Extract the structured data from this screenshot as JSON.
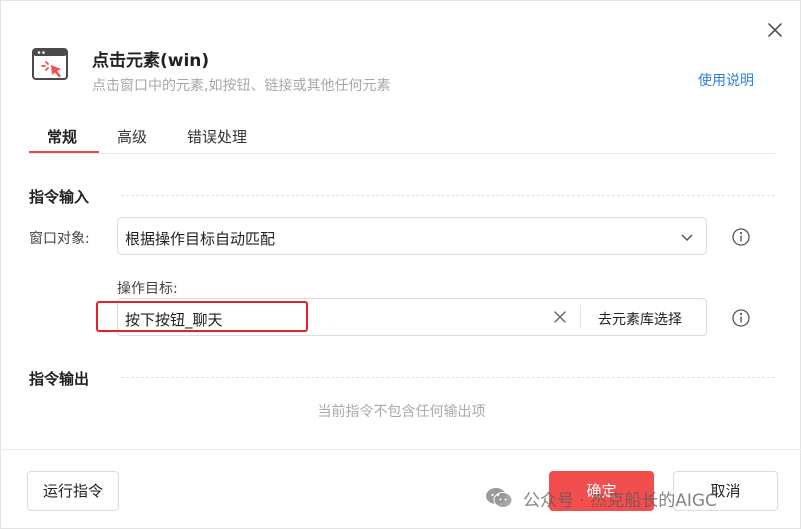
{
  "dialog": {
    "title": "点击元素(win)",
    "subtitle": "点击窗口中的元素,如按钮、链接或其他任何元素",
    "help_link": "使用说明"
  },
  "tabs": [
    {
      "label": "常规",
      "active": true
    },
    {
      "label": "高级",
      "active": false
    },
    {
      "label": "错误处理",
      "active": false
    }
  ],
  "input_section": {
    "title": "指令输入",
    "window_label": "窗口对象:",
    "window_value": "根据操作目标自动匹配",
    "target_label": "操作目标:",
    "target_value": "按下按钮_聊天",
    "pick_button": "去元素库选择"
  },
  "output_section": {
    "title": "指令输出",
    "empty_text": "当前指令不包含任何输出项"
  },
  "footer": {
    "run_button": "运行指令",
    "ok_button": "确定",
    "cancel_button": "取消"
  },
  "watermark": {
    "text": "公众号 · 杰克船长的AIGC"
  },
  "colors": {
    "accent": "#f24e4e",
    "link": "#2f7de1",
    "highlight": "#e8202a"
  },
  "icons": [
    "close-icon",
    "click-element-icon",
    "chevron-down-icon",
    "info-icon",
    "clear-icon",
    "wechat-icon"
  ]
}
